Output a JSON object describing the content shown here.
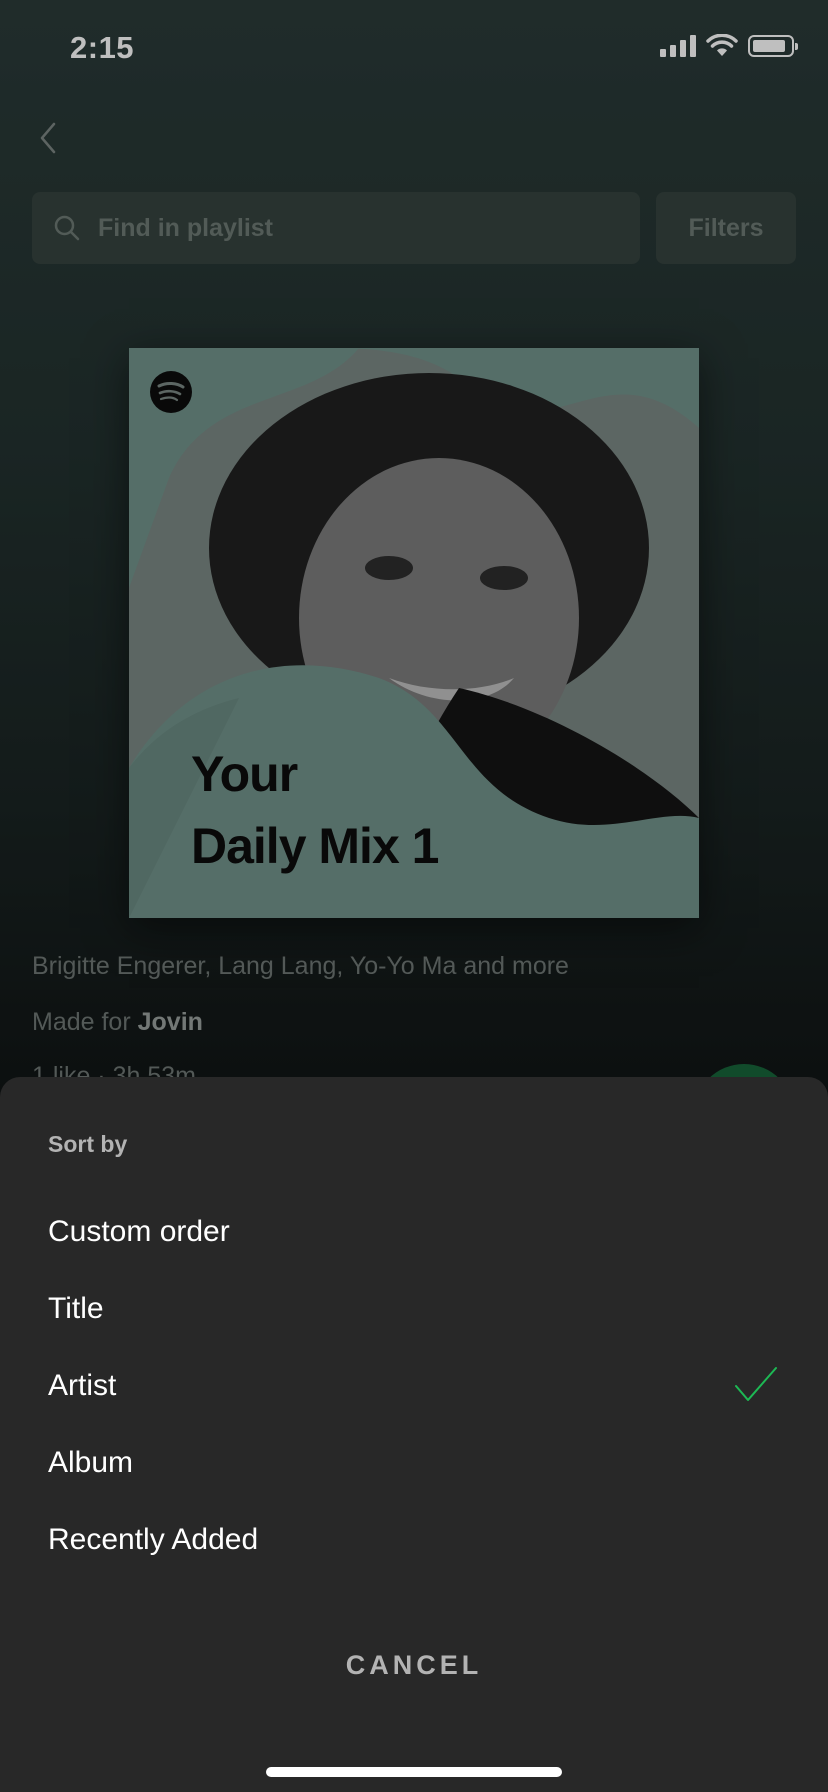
{
  "status_bar": {
    "time": "2:15"
  },
  "search": {
    "placeholder": "Find in playlist"
  },
  "filters_label": "Filters",
  "playlist": {
    "cover_title_line1": "Your",
    "cover_title_line2": "Daily Mix 1",
    "artists": "Brigitte Engerer, Lang Lang, Yo-Yo Ma and more",
    "made_for_prefix": "Made for",
    "made_for_user": "Jovin",
    "meta": "1 like · 3h 53m"
  },
  "sort_sheet": {
    "title": "Sort by",
    "options": [
      {
        "label": "Custom order",
        "selected": false
      },
      {
        "label": "Title",
        "selected": false
      },
      {
        "label": "Artist",
        "selected": true
      },
      {
        "label": "Album",
        "selected": false
      },
      {
        "label": "Recently Added",
        "selected": false
      }
    ],
    "cancel_label": "CANCEL"
  },
  "colors": {
    "accent": "#1db954",
    "sheet_bg": "#282828",
    "cover_teal": "#8fb8ae"
  },
  "icons": {
    "back": "chevron-left-icon",
    "search": "search-icon",
    "check": "check-icon",
    "logo": "spotify-logo-icon"
  }
}
